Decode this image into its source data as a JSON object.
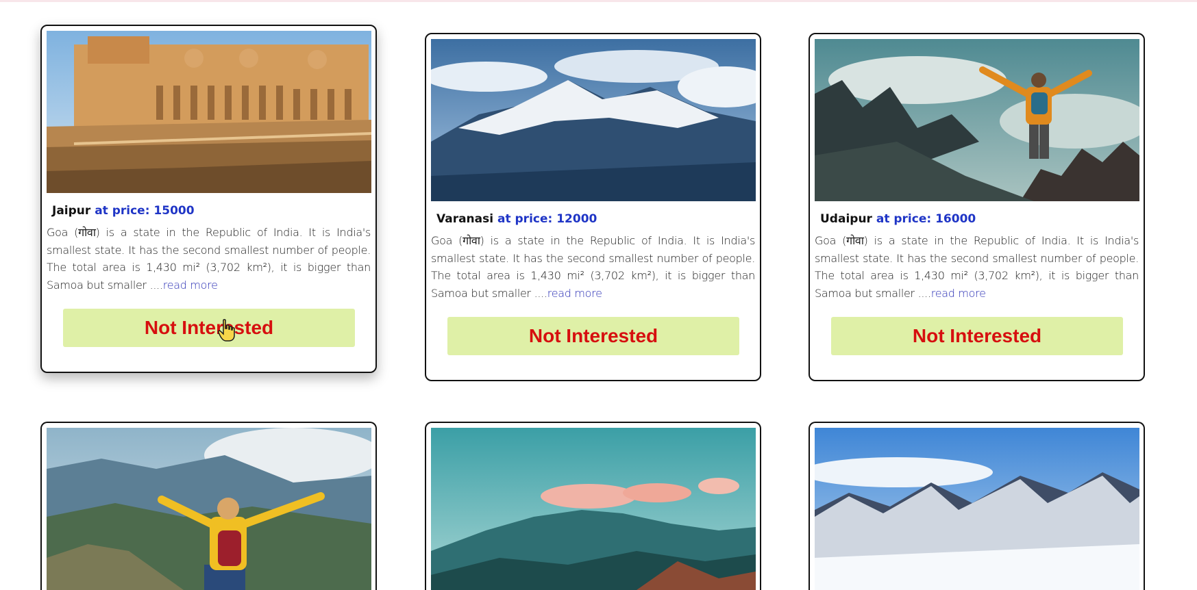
{
  "cards": [
    {
      "name": "Jaipur",
      "price_label": "at price: 15000",
      "description": "Goa (गोवा) is a state in the Republic of India. It is India's smallest state. It has the second smallest number of people. The total area is 1,430 mi² (3,702 km²), it is bigger than Samoa but smaller ....",
      "read_more": "read more",
      "button_label": "Not Interested",
      "image": "amber-fort-image"
    },
    {
      "name": "Varanasi",
      "price_label": "at price: 12000",
      "description": "Goa (गोवा) is a state in the Republic of India. It is India's smallest state. It has the second smallest number of people. The total area is 1,430 mi² (3,702 km²), it is bigger than Samoa but smaller ....",
      "read_more": "read more",
      "button_label": "Not Interested",
      "image": "snowy-mountain-image"
    },
    {
      "name": "Udaipur",
      "price_label": "at price: 16000",
      "description": "Goa (गोवा) is a state in the Republic of India. It is India's smallest state. It has the second smallest number of people. The total area is 1,430 mi² (3,702 km²), it is bigger than Samoa but smaller ....",
      "read_more": "read more",
      "button_label": "Not Interested",
      "image": "hiker-on-peak-image"
    },
    {
      "image": "woman-on-summit-image"
    },
    {
      "image": "pink-clouds-mountain-image"
    },
    {
      "image": "alpine-range-image"
    }
  ],
  "colors": {
    "price": "#1f35c6",
    "button_bg": "#dff0a7",
    "button_text": "#d60f0f",
    "read_more": "#2b30b5"
  },
  "cursor_icon": "hand-pointer-icon"
}
